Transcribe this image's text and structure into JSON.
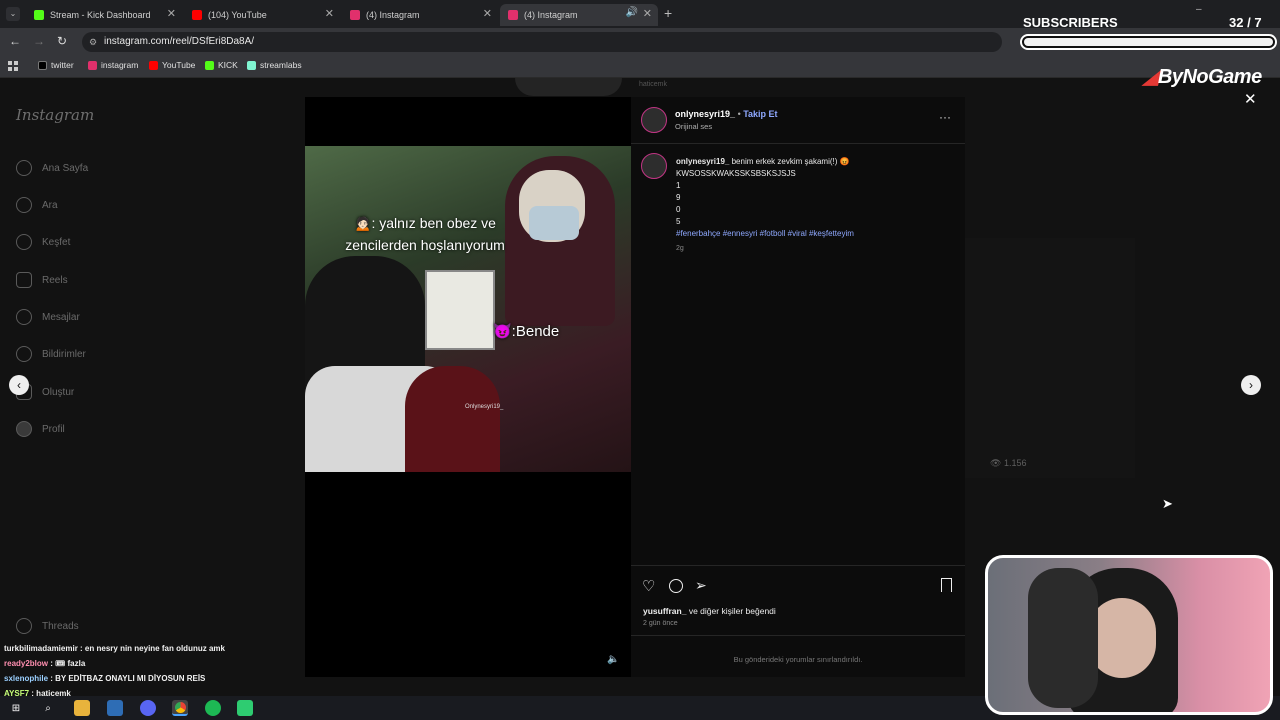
{
  "browser": {
    "tabs": [
      {
        "label": "Stream - Kick Dashboard",
        "color": "#53fc18"
      },
      {
        "label": "(104) YouTube",
        "color": "#ff0000"
      },
      {
        "label": "(4) Instagram",
        "color": "#e1306c"
      },
      {
        "label": "(4) Instagram",
        "color": "#e1306c"
      }
    ],
    "add_tab": "+",
    "url": "instagram.com/reel/DSfEri8Da8A/",
    "bookmarks": [
      {
        "label": "twitter",
        "color": "#111111"
      },
      {
        "label": "instagram",
        "color": "#e1306c"
      },
      {
        "label": "YouTube",
        "color": "#ff0000"
      },
      {
        "label": "KICK",
        "color": "#53fc18"
      },
      {
        "label": "streamlabs",
        "color": "#80f5d2"
      }
    ]
  },
  "overlay": {
    "subscribers_label": "SUBSCRIBERS",
    "sub_count": "32",
    "sub_goal": "/ 7",
    "brand": "ByNoGame"
  },
  "instagram": {
    "logo": "Instagram",
    "nav": [
      "Ana Sayfa",
      "Ara",
      "Keşfet",
      "Reels",
      "Mesajlar",
      "Bildirimler",
      "Oluştur",
      "Profil"
    ],
    "threads": "Threads",
    "bg_name": "haticemk",
    "bg_views": "1.156",
    "post": {
      "username": "onlynesyri19_",
      "follow": "Takip Et",
      "audio": "Orijinal ses",
      "caption_user": "onlynesyri19_",
      "caption_text": "benim erkek zevkim şakami(!) 😡",
      "caption_lines": [
        "KWSOSSKWAKSSKSBSKSJSJS",
        "1",
        "9",
        "0",
        "5"
      ],
      "hashtags": "#fenerbahçe #ennesyri #fotboll #viral #keşfetteyim",
      "time": "2g",
      "video_text_1": "🙍🏻: yalnız ben obez ve zencilerden hoşlanıyorum",
      "video_text_2": "😈:Bende",
      "watermark": "Onlynesyri19_",
      "likes_user": "yusuffran_",
      "likes_text": "ve diğer kişiler beğendi",
      "date": "2 gün önce",
      "comments_limited": "Bu gönderideki yorumlar sınırlandırıldı."
    }
  },
  "chat": [
    {
      "user": "turkbilimadamiemir",
      "msg": ": en nesry nin neyine fan oldunuz amk",
      "color": "#ffffff"
    },
    {
      "user": "ready2blow",
      "msg": ": 🎟 fazla",
      "color": "#ff8fb0"
    },
    {
      "user": "sxlenophile",
      "msg": ": BY EDİTBAZ ONAYLI MI DİYOSUN REİS",
      "color": "#9bd0ff"
    },
    {
      "user": "AYSF7",
      "msg": ": haticemk",
      "color": "#c7ff7a"
    }
  ]
}
